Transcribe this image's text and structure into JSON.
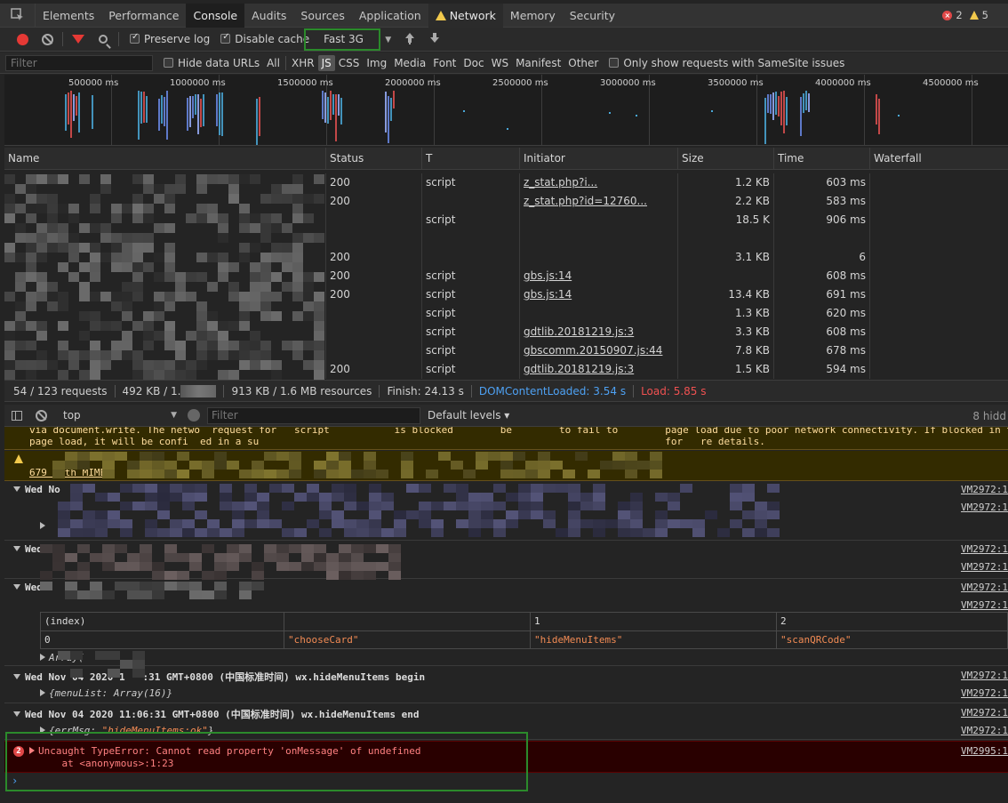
{
  "tabs": [
    {
      "label": "Elements"
    },
    {
      "label": "Performance"
    },
    {
      "label": "Console"
    },
    {
      "label": "Audits"
    },
    {
      "label": "Sources"
    },
    {
      "label": "Application"
    },
    {
      "label": "Network"
    },
    {
      "label": "Memory"
    },
    {
      "label": "Security"
    }
  ],
  "issue_counts": {
    "errors": "2",
    "warnings": "5"
  },
  "network_toolbar": {
    "preserve_log": "Preserve log",
    "disable_cache": "Disable cache",
    "throttling": "Fast 3G"
  },
  "filter_bar": {
    "placeholder": "Filter",
    "hide_data_urls": "Hide data URLs",
    "types": [
      "All",
      "XHR",
      "JS",
      "CSS",
      "Img",
      "Media",
      "Font",
      "Doc",
      "WS",
      "Manifest",
      "Other"
    ],
    "active_type": "JS",
    "samesite": "Only show requests with SameSite issues"
  },
  "overview": {
    "ticks": [
      "500000 ms",
      "1000000 ms",
      "1500000 ms",
      "2000000 ms",
      "2500000 ms",
      "3000000 ms",
      "3500000 ms",
      "4000000 ms",
      "4500000 ms"
    ]
  },
  "table": {
    "columns": [
      "Name",
      "Status",
      "T",
      "Initiator",
      "Size",
      "Time",
      "Waterfall"
    ],
    "rows": [
      {
        "status": "200",
        "type": "script",
        "initiator": "z_stat.php?i...",
        "size": "1.2 KB",
        "time": "603 ms"
      },
      {
        "status": "200",
        "type": "",
        "initiator": "z_stat.php?id=12760...",
        "size": "2.2 KB",
        "time": "583 ms"
      },
      {
        "status": "",
        "type": "script",
        "initiator": "",
        "size": "18.5 K",
        "time": "906 ms"
      },
      {
        "status": "",
        "type": "",
        "initiator": "",
        "size": "",
        "time": ""
      },
      {
        "status": "200",
        "type": "",
        "initiator": "",
        "size": "3.1 KB",
        "time": "6"
      },
      {
        "status": "200",
        "type": "script",
        "initiator": "gbs.js:14",
        "size": "",
        "time": "608 ms"
      },
      {
        "status": "200",
        "type": "script",
        "initiator": "gbs.js:14",
        "size": "13.4 KB",
        "time": "691 ms"
      },
      {
        "status": "",
        "type": "script",
        "initiator": "",
        "size": "1.3 KB",
        "time": "620 ms"
      },
      {
        "status": "",
        "type": "script",
        "initiator": "gdtlib.20181219.js:3",
        "size": "3.3 KB",
        "time": "608 ms"
      },
      {
        "status": "",
        "type": "script",
        "initiator": "gbscomm.20150907.js:44",
        "size": "7.8 KB",
        "time": "678 ms"
      },
      {
        "status": "200",
        "type": "script",
        "initiator": "gdtlib.20181219.js:3",
        "size": "1.5 KB",
        "time": "594 ms"
      }
    ]
  },
  "summary": {
    "requests": "54 / 123 requests",
    "transferred": "492 KB / 1.",
    "resources": "913 KB / 1.6 MB resources",
    "finish": "Finish: 24.13 s",
    "dom_content_loaded": "DOMContentLoaded: 3.54 s",
    "load": "Load: 5.85 s"
  },
  "console_toolbar": {
    "context": "top",
    "filter_placeholder": "Filter",
    "levels": "Default levels ▾",
    "hidden": "8 hidd"
  },
  "console": {
    "warn_line1": "via document.write. The netwo  request for   script           is blocked        be        to fail to        page load due to poor network connectivity. If blocked in thi",
    "warn_line2": "page load, it will be confi  ed in a su                                                                     for   re details.",
    "warn2_line2": "679 with MIME",
    "group1_header": "Wed No",
    "group1_src": "VM2972:1",
    "group1b_src": "VM2972:1",
    "group2_header": "Wed",
    "group2_src": "VM2972:1",
    "group2b_src": "VM2972:1",
    "group3_header": "Wed",
    "group3_src": "VM2972:1",
    "group3b_src": "VM2972:1",
    "table_headers": [
      "(index)",
      "",
      "1",
      "2"
    ],
    "table_row": [
      "0",
      "\"chooseCard\"",
      "\"hideMenuItems\"",
      "\"scanQRCode\""
    ],
    "array_label": "Array(",
    "group4_header": "Wed Nov 04 2020 1   :31 GMT+0800 (中国标准时间) wx.hideMenuItems begin",
    "group4_src": "VM2972:1",
    "group4_obj": "{menuList: Array(16)}",
    "group4b_src": "VM2972:1",
    "group5_header": "Wed Nov 04 2020 11:06:31 GMT+0800 (中国标准时间) wx.hideMenuItems end",
    "group5_src": "VM2972:1",
    "group5_obj_key": "{errMsg: ",
    "group5_obj_val": "\"hideMenuItems:ok\"",
    "group5_obj_end": "}",
    "group5b_src": "VM2972:1",
    "error_badge": "2",
    "error_line1": "Uncaught TypeError: Cannot read property 'onMessage' of undefined",
    "error_line2": "    at <anonymous>:1:23",
    "error_src": "VM2995:1"
  },
  "colors": {
    "accent_green": "#2b8a2b",
    "error_red": "#e04848",
    "dom_blue": "#4ea1f3",
    "load_red": "#f05151"
  }
}
